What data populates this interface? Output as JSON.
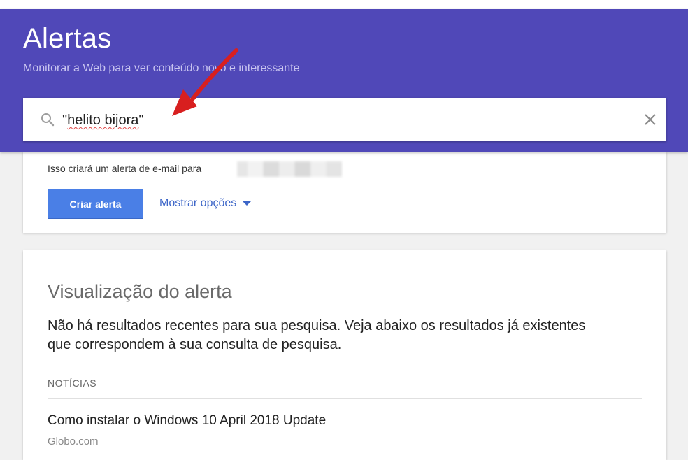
{
  "header": {
    "title": "Alertas",
    "subtitle": "Monitorar a Web para ver conteúdo novo e interessante",
    "background_color": "#5048b8"
  },
  "search": {
    "value_quote_open": "\"",
    "value_word": "helito bijora",
    "value_quote_close": "\"",
    "search_icon": "search-icon",
    "clear_icon": "close-icon"
  },
  "create_card": {
    "email_note": "Isso criará um alerta de e-mail para",
    "create_button_label": "Criar alerta",
    "options_link_label": "Mostrar opções",
    "button_color": "#4a7fe6",
    "link_color": "#3d66c8"
  },
  "preview_card": {
    "heading": "Visualização do alerta",
    "no_results_text": "Não há resultados recentes para sua pesquisa. Veja abaixo os resultados já existentes que correspondem à sua consulta de pesquisa.",
    "section_label": "NOTÍCIAS",
    "articles": [
      {
        "title": "Como instalar o Windows 10 April 2018 Update",
        "source": "Globo.com"
      }
    ]
  },
  "annotation": {
    "arrow_color": "#d81f1f"
  }
}
